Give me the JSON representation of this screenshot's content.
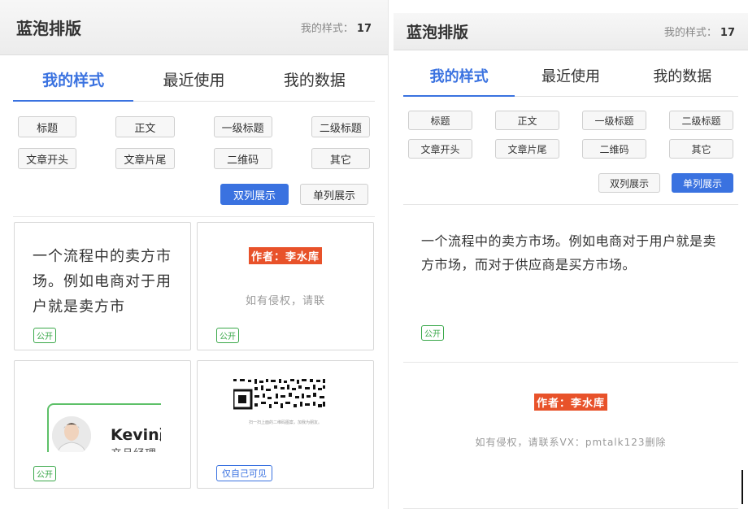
{
  "header": {
    "title": "蓝泡排版",
    "count_label": "我的样式：",
    "count": "17"
  },
  "tabs": [
    {
      "label": "我的样式"
    },
    {
      "label": "最近使用"
    },
    {
      "label": "我的数据"
    }
  ],
  "chips": [
    "标题",
    "正文",
    "一级标题",
    "二级标题",
    "文章开头",
    "文章片尾",
    "二维码",
    "其它"
  ],
  "view": {
    "double_label": "双列展示",
    "single_label": "单列展示"
  },
  "cards": {
    "text_snippet": "一个流程中的卖方市场。例如电商对于用户就是卖方市",
    "author": "作者：李水库",
    "copyright_short": "如有侵权，请联",
    "kevin_name": "Kevin改",
    "kevin_sub": "产品经理",
    "qr_caption": "扫一扫上面的二维码图案，加我为朋友。",
    "public_badge": "公开",
    "private_badge": "仅自己可见"
  },
  "right": {
    "paragraph": "一个流程中的卖方市场。例如电商对于用户就是卖方市场，而对于供应商是买方市场。",
    "author": "作者：李水库",
    "copyright": "如有侵权，请联系VX：pmtalk123删除",
    "public_badge": "公开"
  }
}
